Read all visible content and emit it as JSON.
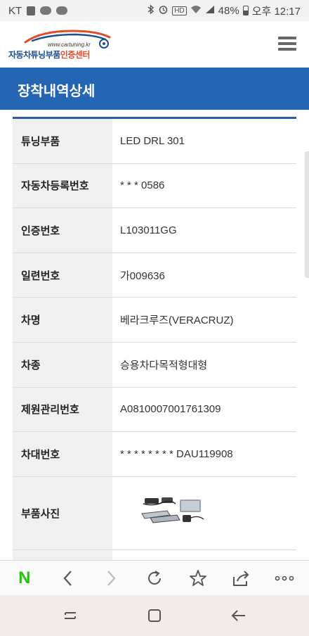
{
  "status_bar": {
    "carrier": "KT",
    "hd_label": "HD",
    "battery": "48%",
    "time": "오후 12:17"
  },
  "header": {
    "logo_url": "www.cartuning.kr",
    "logo_name_main": "자동차튜닝부품",
    "logo_name_accent": "인증센터",
    "menu_icon": "hamburger-menu-icon"
  },
  "page_title": "장착내역상세",
  "details": [
    {
      "label": "튜닝부품",
      "value": "LED DRL 301"
    },
    {
      "label": "자동차등록번호",
      "value": "* * * 0586"
    },
    {
      "label": "인증번호",
      "value": "L103011GG"
    },
    {
      "label": "일련번호",
      "value": "가009636"
    },
    {
      "label": "차명",
      "value": "베라크루즈(VERACRUZ)"
    },
    {
      "label": "차종",
      "value": "승용차다목적형대형"
    },
    {
      "label": "제원관리번호",
      "value": "A0810007001761309"
    },
    {
      "label": "차대번호",
      "value": "* * * * * * * * DAU119908"
    }
  ],
  "photo_row": {
    "label": "부품사진"
  },
  "browser_toolbar": {
    "naver_label": "N",
    "icons": [
      "back-icon",
      "forward-icon",
      "reload-icon",
      "bookmark-star-icon",
      "share-icon",
      "more-icon"
    ]
  },
  "system_nav": {
    "icons": [
      "recent-apps-icon",
      "home-icon",
      "back-icon"
    ]
  },
  "colors": {
    "title_bar": "#2466b3",
    "table_top_border": "#2a5aa0",
    "label_bg": "#f0f0f0",
    "naver_green": "#1ec800",
    "logo_blue": "#1d4f8c",
    "logo_accent": "#e24b2a"
  }
}
